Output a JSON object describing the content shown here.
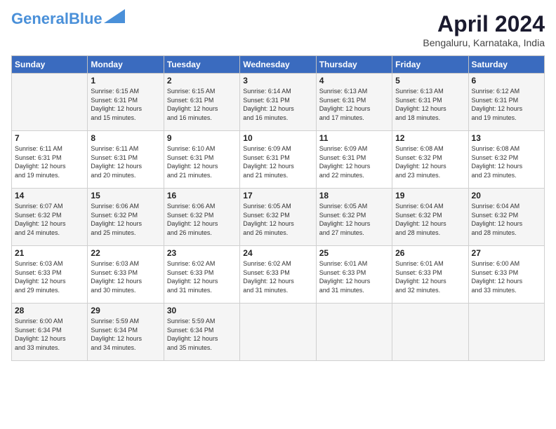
{
  "logo": {
    "general": "General",
    "blue": "Blue"
  },
  "header": {
    "month": "April 2024",
    "location": "Bengaluru, Karnataka, India"
  },
  "weekdays": [
    "Sunday",
    "Monday",
    "Tuesday",
    "Wednesday",
    "Thursday",
    "Friday",
    "Saturday"
  ],
  "weeks": [
    [
      {
        "day": "",
        "info": ""
      },
      {
        "day": "1",
        "info": "Sunrise: 6:15 AM\nSunset: 6:31 PM\nDaylight: 12 hours\nand 15 minutes."
      },
      {
        "day": "2",
        "info": "Sunrise: 6:15 AM\nSunset: 6:31 PM\nDaylight: 12 hours\nand 16 minutes."
      },
      {
        "day": "3",
        "info": "Sunrise: 6:14 AM\nSunset: 6:31 PM\nDaylight: 12 hours\nand 16 minutes."
      },
      {
        "day": "4",
        "info": "Sunrise: 6:13 AM\nSunset: 6:31 PM\nDaylight: 12 hours\nand 17 minutes."
      },
      {
        "day": "5",
        "info": "Sunrise: 6:13 AM\nSunset: 6:31 PM\nDaylight: 12 hours\nand 18 minutes."
      },
      {
        "day": "6",
        "info": "Sunrise: 6:12 AM\nSunset: 6:31 PM\nDaylight: 12 hours\nand 19 minutes."
      }
    ],
    [
      {
        "day": "7",
        "info": "Sunrise: 6:11 AM\nSunset: 6:31 PM\nDaylight: 12 hours\nand 19 minutes."
      },
      {
        "day": "8",
        "info": "Sunrise: 6:11 AM\nSunset: 6:31 PM\nDaylight: 12 hours\nand 20 minutes."
      },
      {
        "day": "9",
        "info": "Sunrise: 6:10 AM\nSunset: 6:31 PM\nDaylight: 12 hours\nand 21 minutes."
      },
      {
        "day": "10",
        "info": "Sunrise: 6:09 AM\nSunset: 6:31 PM\nDaylight: 12 hours\nand 21 minutes."
      },
      {
        "day": "11",
        "info": "Sunrise: 6:09 AM\nSunset: 6:31 PM\nDaylight: 12 hours\nand 22 minutes."
      },
      {
        "day": "12",
        "info": "Sunrise: 6:08 AM\nSunset: 6:32 PM\nDaylight: 12 hours\nand 23 minutes."
      },
      {
        "day": "13",
        "info": "Sunrise: 6:08 AM\nSunset: 6:32 PM\nDaylight: 12 hours\nand 23 minutes."
      }
    ],
    [
      {
        "day": "14",
        "info": "Sunrise: 6:07 AM\nSunset: 6:32 PM\nDaylight: 12 hours\nand 24 minutes."
      },
      {
        "day": "15",
        "info": "Sunrise: 6:06 AM\nSunset: 6:32 PM\nDaylight: 12 hours\nand 25 minutes."
      },
      {
        "day": "16",
        "info": "Sunrise: 6:06 AM\nSunset: 6:32 PM\nDaylight: 12 hours\nand 26 minutes."
      },
      {
        "day": "17",
        "info": "Sunrise: 6:05 AM\nSunset: 6:32 PM\nDaylight: 12 hours\nand 26 minutes."
      },
      {
        "day": "18",
        "info": "Sunrise: 6:05 AM\nSunset: 6:32 PM\nDaylight: 12 hours\nand 27 minutes."
      },
      {
        "day": "19",
        "info": "Sunrise: 6:04 AM\nSunset: 6:32 PM\nDaylight: 12 hours\nand 28 minutes."
      },
      {
        "day": "20",
        "info": "Sunrise: 6:04 AM\nSunset: 6:32 PM\nDaylight: 12 hours\nand 28 minutes."
      }
    ],
    [
      {
        "day": "21",
        "info": "Sunrise: 6:03 AM\nSunset: 6:33 PM\nDaylight: 12 hours\nand 29 minutes."
      },
      {
        "day": "22",
        "info": "Sunrise: 6:03 AM\nSunset: 6:33 PM\nDaylight: 12 hours\nand 30 minutes."
      },
      {
        "day": "23",
        "info": "Sunrise: 6:02 AM\nSunset: 6:33 PM\nDaylight: 12 hours\nand 31 minutes."
      },
      {
        "day": "24",
        "info": "Sunrise: 6:02 AM\nSunset: 6:33 PM\nDaylight: 12 hours\nand 31 minutes."
      },
      {
        "day": "25",
        "info": "Sunrise: 6:01 AM\nSunset: 6:33 PM\nDaylight: 12 hours\nand 31 minutes."
      },
      {
        "day": "26",
        "info": "Sunrise: 6:01 AM\nSunset: 6:33 PM\nDaylight: 12 hours\nand 32 minutes."
      },
      {
        "day": "27",
        "info": "Sunrise: 6:00 AM\nSunset: 6:33 PM\nDaylight: 12 hours\nand 33 minutes."
      }
    ],
    [
      {
        "day": "28",
        "info": "Sunrise: 6:00 AM\nSunset: 6:34 PM\nDaylight: 12 hours\nand 33 minutes."
      },
      {
        "day": "29",
        "info": "Sunrise: 5:59 AM\nSunset: 6:34 PM\nDaylight: 12 hours\nand 34 minutes."
      },
      {
        "day": "30",
        "info": "Sunrise: 5:59 AM\nSunset: 6:34 PM\nDaylight: 12 hours\nand 35 minutes."
      },
      {
        "day": "",
        "info": ""
      },
      {
        "day": "",
        "info": ""
      },
      {
        "day": "",
        "info": ""
      },
      {
        "day": "",
        "info": ""
      }
    ]
  ]
}
